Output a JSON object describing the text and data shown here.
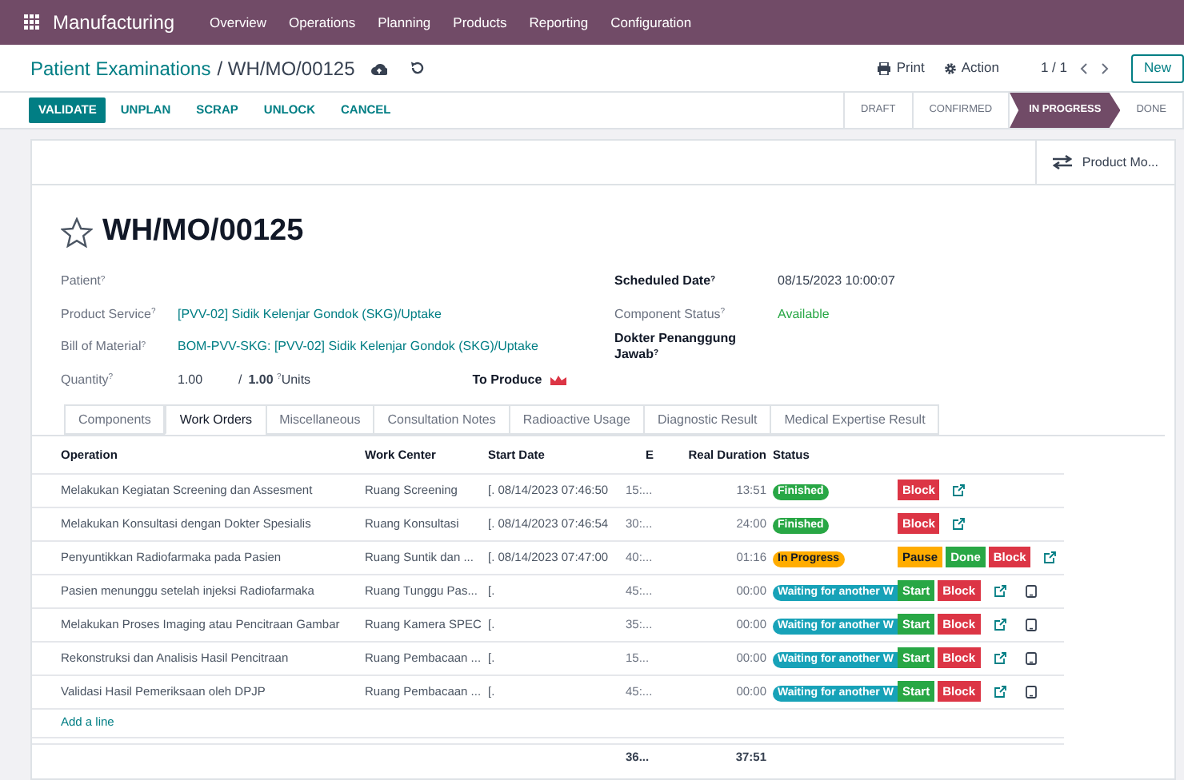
{
  "navbar": {
    "app": "Manufacturing",
    "menu": [
      "Overview",
      "Operations",
      "Planning",
      "Products",
      "Reporting",
      "Configuration"
    ]
  },
  "breadcrumb": {
    "parent": "Patient Examinations",
    "current": "/ WH/MO/00125"
  },
  "control_panel": {
    "print": "Print",
    "action": "Action",
    "pager": "1 / 1",
    "new": "New"
  },
  "actions": [
    {
      "label": "VALIDATE",
      "primary": true
    },
    {
      "label": "UNPLAN",
      "primary": false
    },
    {
      "label": "SCRAP",
      "primary": false
    },
    {
      "label": "UNLOCK",
      "primary": false
    },
    {
      "label": "CANCEL",
      "primary": false
    }
  ],
  "stages": [
    {
      "label": "DRAFT",
      "selected": false
    },
    {
      "label": "CONFIRMED",
      "selected": false
    },
    {
      "label": "IN PROGRESS",
      "selected": true
    },
    {
      "label": "DONE",
      "selected": false
    }
  ],
  "smart_button": "Product Mo...",
  "title": "WH/MO/00125",
  "left_fields": [
    {
      "label": "Patient$^{?}$"
    },
    {
      "label": "Product Service$^{?}$",
      "value": "[PVV-02] Sidik Kelenjar Gondok (SKG)/Uptake"
    },
    {
      "label": "Bill of Material$^{?}$",
      "value": "BOM-PVV-SKG: [PVV-02] Sidik Kelenjar Gondok (SKG)/Uptake"
    }
  ],
  "quantity": {
    "label": "Quantity$^{?}$",
    "value": "1.00",
    "separator": "/",
    "target": "**1.00** $^{?}$Units",
    "to_produce": "To Produce"
  },
  "right_fields": [
    {
      "label": "Scheduled Date$^{?}$",
      "value": "08/15/2023 10:00:07",
      "kind": "bold"
    },
    {
      "label": "Component Status$^{?}$",
      "value": "Available",
      "kind": "status"
    },
    {
      "label": "Dokter Penanggung Jawab$^{?}$",
      "kind": "bold"
    }
  ],
  "tabs": [
    {
      "label": "Components",
      "selected": false
    },
    {
      "label": "Work Orders",
      "selected": true
    },
    {
      "label": "Miscellaneous",
      "selected": false
    },
    {
      "label": "Consultation Notes",
      "selected": false
    },
    {
      "label": "Radioactive Usage",
      "selected": false
    },
    {
      "label": "Diagnostic Result",
      "selected": false
    },
    {
      "label": "Medical Expertise Result",
      "selected": false
    }
  ],
  "table": {
    "columns": [
      "Operation",
      "Work Center",
      "Start Date",
      "E",
      "Real Duration",
      "Status"
    ],
    "rows": [
      {
        "operation": "Melakukan Kegiatan Screening dan Assesment",
        "work_center": "Ruang Screening",
        "start_date": "[. 08/14/2023 07:46:50",
        "expected": "15:...",
        "real": "13:51",
        "status": {
          "label": "Finished",
          "kind": "done"
        },
        "buttons": [
          {
            "label": "Block",
            "kind": "block"
          }
        ],
        "tablet": false
      },
      {
        "operation": "Melakukan Konsultasi dengan Dokter Spesialis",
        "work_center": "Ruang Konsultasi",
        "start_date": "[. 08/14/2023 07:46:54",
        "expected": "30:...",
        "real": "24:00",
        "status": {
          "label": "Finished",
          "kind": "done"
        },
        "buttons": [
          {
            "label": "Block",
            "kind": "block"
          }
        ],
        "tablet": false
      },
      {
        "operation": "Penyuntikkan Radiofarmaka pada Pasien",
        "work_center": "Ruang Suntik dan ...",
        "start_date": "[. 08/14/2023 07:47:00",
        "expected": "40:...",
        "real": "01:16",
        "status": {
          "label": "In Progress",
          "kind": "progress"
        },
        "buttons": [
          {
            "label": "Pause",
            "kind": "pause"
          },
          {
            "label": "Done",
            "kind": "go"
          },
          {
            "label": "Block",
            "kind": "block"
          }
        ],
        "tablet": false
      },
      {
        "operation": "Pasien menunggu setelah injeksi Radiofarmaka",
        "work_center": "Ruang Tunggu Pas...",
        "start_date": "[.",
        "expected": "45:...",
        "real": "00:00",
        "status": {
          "label": "Waiting for another W",
          "kind": "waiting"
        },
        "buttons": [
          {
            "label": "Start",
            "kind": "go"
          },
          {
            "label": "Block",
            "kind": "block"
          }
        ],
        "tablet": true
      },
      {
        "operation": "Melakukan Proses Imaging atau Pencitraan Gambar",
        "work_center": "Ruang Kamera SPEC",
        "start_date": "[.",
        "expected": "35:...",
        "real": "00:00",
        "status": {
          "label": "Waiting for another W",
          "kind": "waiting"
        },
        "buttons": [
          {
            "label": "Start",
            "kind": "go"
          },
          {
            "label": "Block",
            "kind": "block"
          }
        ],
        "tablet": true
      },
      {
        "operation": "Rekonstruksi dan Analisis Hasil Pencitraan",
        "work_center": "Ruang Pembacaan ...",
        "start_date": "[.",
        "expected": "15...",
        "real": "00:00",
        "status": {
          "label": "Waiting for another W",
          "kind": "waiting"
        },
        "buttons": [
          {
            "label": "Start",
            "kind": "go"
          },
          {
            "label": "Block",
            "kind": "block"
          }
        ],
        "tablet": true
      },
      {
        "operation": "Validasi Hasil Pemeriksaan oleh DPJP",
        "work_center": "Ruang Pembacaan ...",
        "start_date": "[.",
        "expected": "45:...",
        "real": "00:00",
        "status": {
          "label": "Waiting for another W",
          "kind": "waiting"
        },
        "buttons": [
          {
            "label": "Start",
            "kind": "go"
          },
          {
            "label": "Block",
            "kind": "block"
          }
        ],
        "tablet": true
      }
    ],
    "add_line": "Add a line",
    "totals": {
      "expected": "36...",
      "real": "37:51"
    }
  }
}
